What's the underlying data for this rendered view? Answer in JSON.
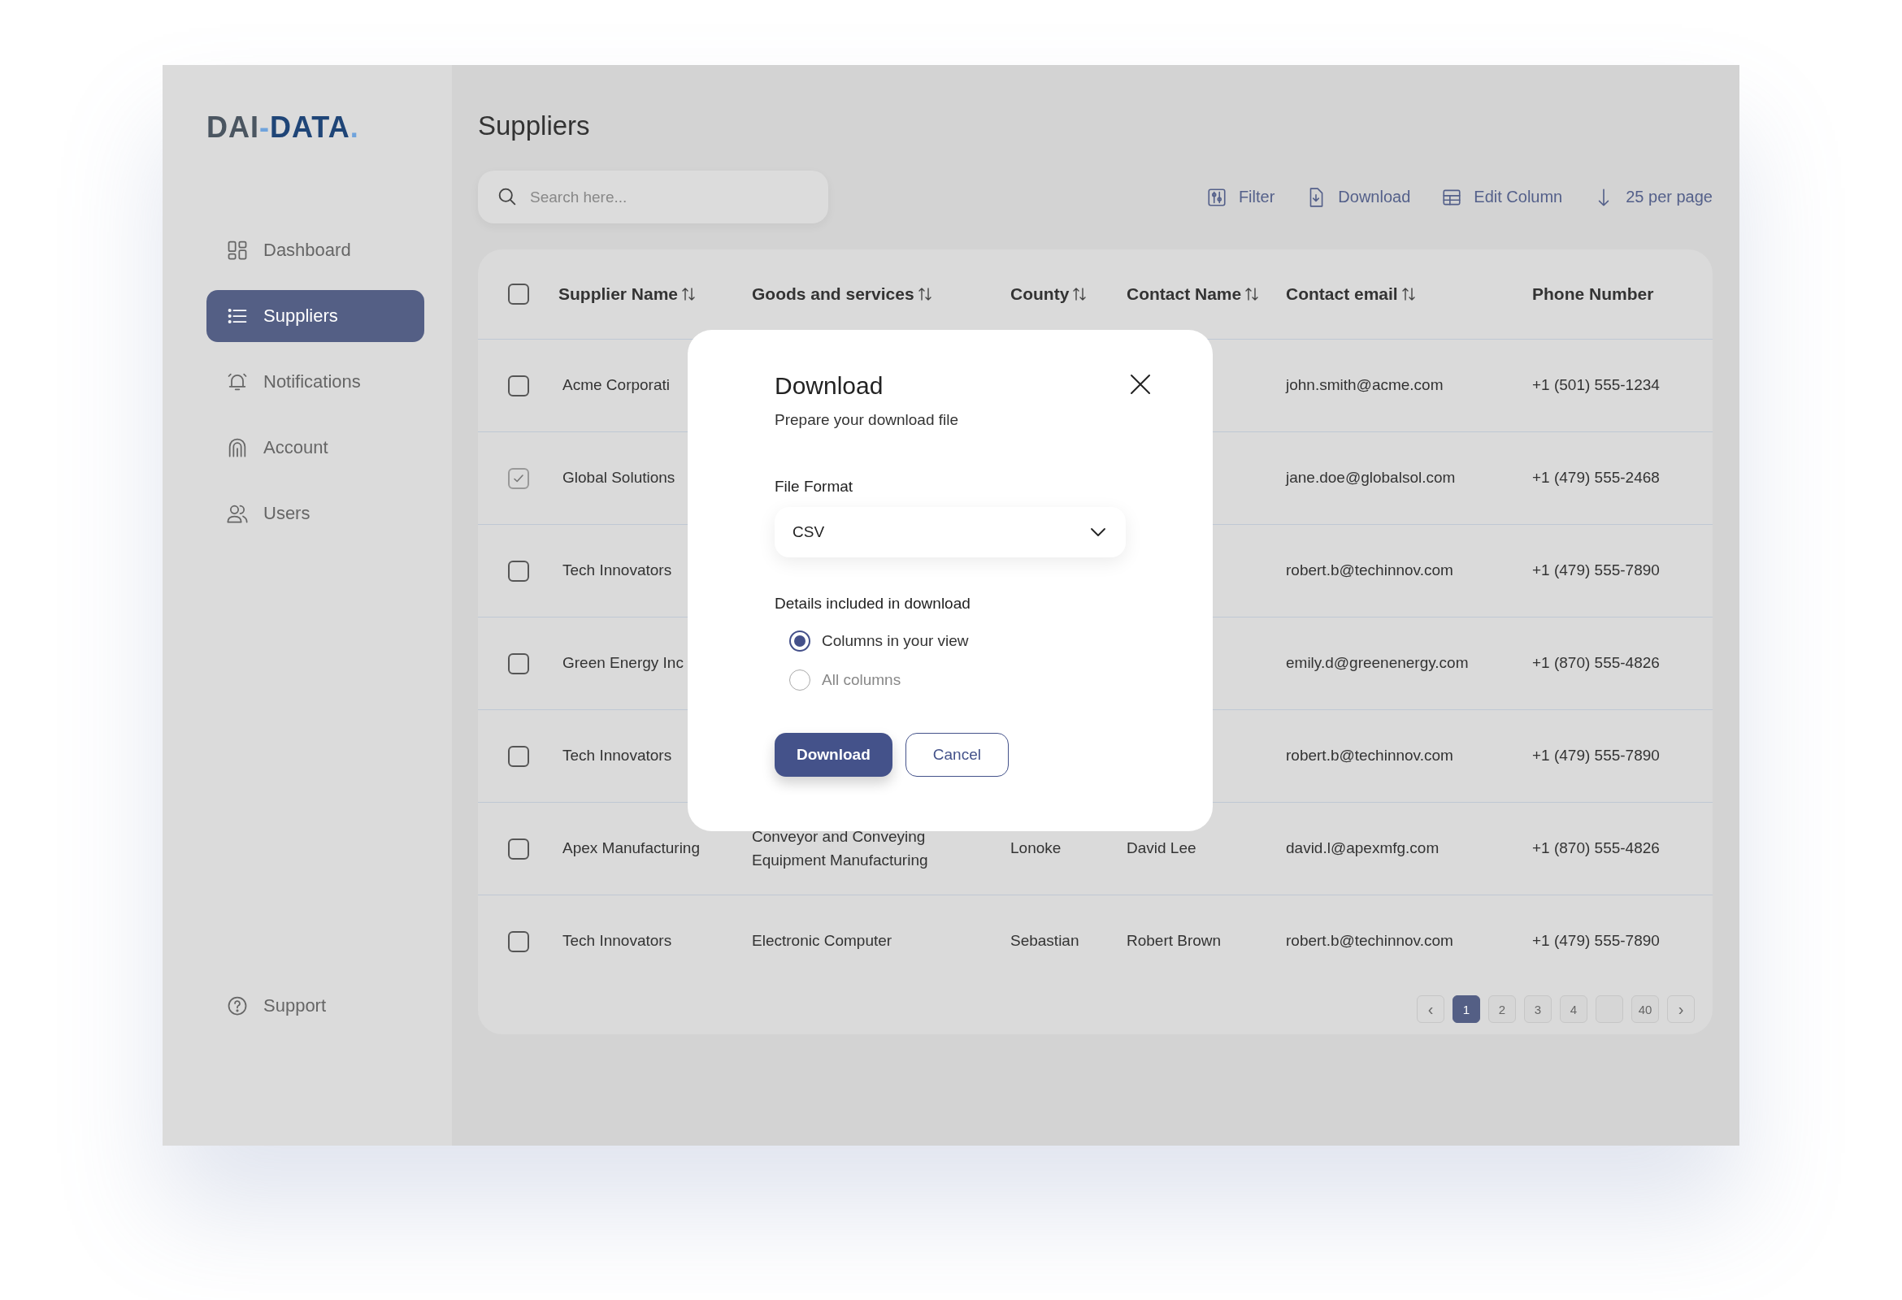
{
  "logo": {
    "parts": [
      {
        "text": "DAI",
        "color": "#4b5661"
      },
      {
        "text": "-",
        "color": "#6fa3dc"
      },
      {
        "text": "DATA",
        "color": "#1f4577"
      },
      {
        "text": ".",
        "color": "#6fa3dc"
      }
    ]
  },
  "sidebar": {
    "items": [
      {
        "label": "Dashboard",
        "selected": false
      },
      {
        "label": "Suppliers",
        "selected": true
      },
      {
        "label": "Notifications",
        "selected": false
      },
      {
        "label": "Account",
        "selected": false
      },
      {
        "label": "Users",
        "selected": false
      }
    ],
    "footer": [
      {
        "label": "Support",
        "selected": false
      }
    ]
  },
  "page": {
    "title": "Suppliers"
  },
  "search": {
    "placeholder": "Search here..."
  },
  "toolbar": [
    {
      "label": "Filter"
    },
    {
      "label": "Download"
    },
    {
      "label": "Edit Column"
    },
    {
      "label": "25 per page"
    }
  ],
  "table": {
    "header_checked": false,
    "columns": [
      {
        "label": "Supplier Name",
        "sortable": true
      },
      {
        "label": "Goods and services",
        "sortable": true
      },
      {
        "label": "County",
        "sortable": true
      },
      {
        "label": "Contact Name",
        "sortable": true
      },
      {
        "label": "Contact email",
        "sortable": true
      },
      {
        "label": "Phone Number",
        "sortable": false
      }
    ],
    "rows": [
      {
        "checked": false,
        "cells": [
          "Acme Corporati",
          null,
          null,
          null,
          "john.smith@acme.com",
          "+1 (501) 555-1234"
        ]
      },
      {
        "checked": true,
        "cells": [
          "Global Solutions",
          null,
          null,
          null,
          "jane.doe@globalsol.com",
          "+1 (479) 555-2468"
        ]
      },
      {
        "checked": false,
        "cells": [
          "Tech Innovators",
          null,
          null,
          null,
          "robert.b@techinnov.com",
          "+1 (479) 555-7890"
        ]
      },
      {
        "checked": false,
        "cells": [
          "Green Energy Inc",
          null,
          null,
          null,
          "emily.d@greenenergy.com",
          "+1 (870) 555-4826"
        ]
      },
      {
        "checked": false,
        "cells": [
          "Tech Innovators",
          null,
          null,
          null,
          "robert.b@techinnov.com",
          "+1 (479) 555-7890"
        ]
      },
      {
        "checked": false,
        "cells": [
          "Apex Manufacturing",
          "Conveyor and Conveying Equipment Manufacturing",
          "Lonoke",
          "David Lee",
          "david.l@apexmfg.com",
          "+1 (870) 555-4826"
        ]
      },
      {
        "checked": false,
        "cells": [
          "Tech Innovators",
          "Electronic Computer",
          "Sebastian",
          "Robert Brown",
          "robert.b@techinnov.com",
          "+1 (479) 555-7890"
        ]
      }
    ]
  },
  "pagination": [
    {
      "kind": "arrow",
      "label": "‹",
      "selected": false
    },
    {
      "kind": "page",
      "label": "1",
      "selected": true
    },
    {
      "kind": "page",
      "label": "2",
      "selected": false
    },
    {
      "kind": "page",
      "label": "3",
      "selected": false
    },
    {
      "kind": "page",
      "label": "4",
      "selected": false
    },
    {
      "kind": "gap",
      "selected": false
    },
    {
      "kind": "page",
      "label": "40",
      "selected": false
    },
    {
      "kind": "arrow",
      "label": "›",
      "selected": false
    }
  ],
  "dialog": {
    "title": "Download",
    "subtitle": "Prepare your download file",
    "format_label": "File Format",
    "format_value": "CSV",
    "details_label": "Details included in download",
    "options": [
      {
        "label": "Columns in your view",
        "selected": true
      },
      {
        "label": "All columns",
        "selected": false
      }
    ],
    "buttons": [
      {
        "label": "Download",
        "kind": "primary"
      },
      {
        "label": "Cancel",
        "kind": "secondary"
      }
    ]
  }
}
